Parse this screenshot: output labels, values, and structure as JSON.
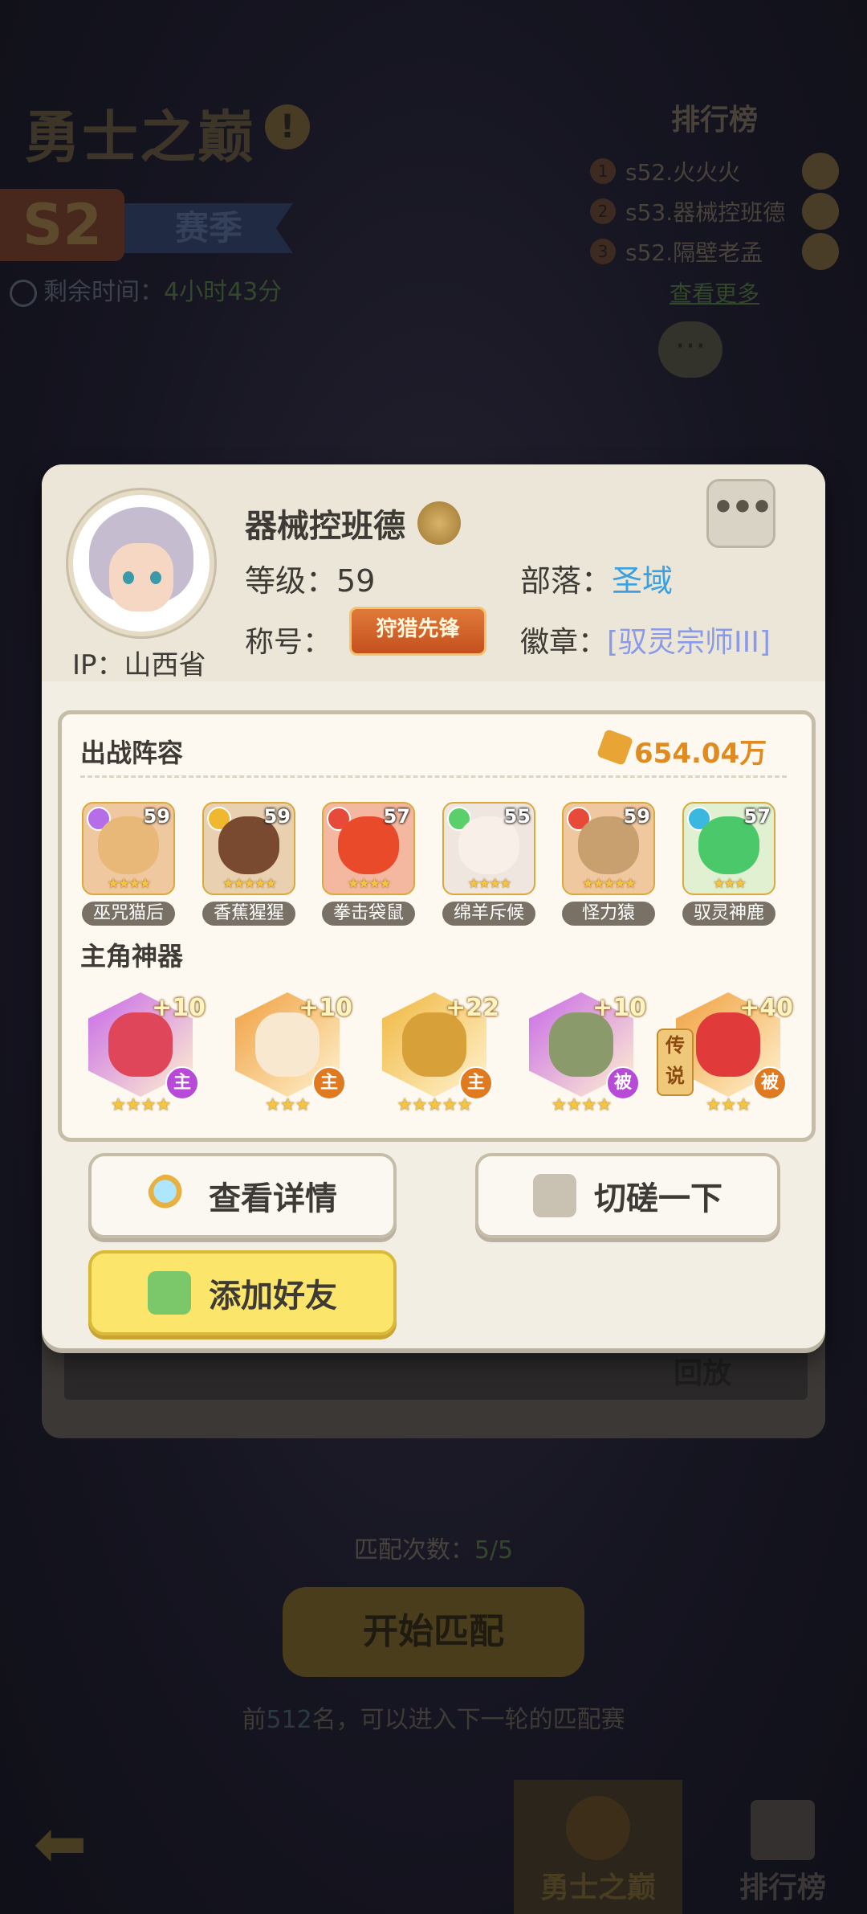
{
  "header": {
    "game_title": "勇士之巅",
    "info_icon": "!",
    "season_code": "S2",
    "season_label": "赛季",
    "remaining_label": "剩余时间：",
    "remaining_value": "4小时43分"
  },
  "ranking": {
    "title": "排行榜",
    "entries": [
      {
        "rank": "1",
        "name": "s52.火火火"
      },
      {
        "rank": "2",
        "name": "s53.器械控班德"
      },
      {
        "rank": "3",
        "name": "s52.隔壁老孟"
      }
    ],
    "see_more": "查看更多"
  },
  "chat_icon": "chat-bubble-icon",
  "profile": {
    "name": "器械控班德",
    "level_label": "等级：",
    "level_value": "59",
    "tribe_label": "部落：",
    "tribe_value": "圣域",
    "title_label": "称号：",
    "title_value": "狩猎先锋",
    "badge_label": "徽章：",
    "badge_value": "[驭灵宗师III]",
    "ip_label": "IP：山西省",
    "more_label": "•••"
  },
  "lineup": {
    "title": "出战阵容",
    "power": "654.04万",
    "heroes": [
      {
        "name": "巫咒猫后",
        "level": "59",
        "stars": "★★★★",
        "element_color": "#b56ee8",
        "bg": "#f0c8a0",
        "skin": "#e8b878"
      },
      {
        "name": "香蕉猩猩",
        "level": "59",
        "stars": "★★★★★",
        "element_color": "#f0b830",
        "bg": "#e8d0b0",
        "skin": "#7a4a30"
      },
      {
        "name": "拳击袋鼠",
        "level": "57",
        "stars": "★★★★",
        "element_color": "#e84a3a",
        "bg": "#f4b8a0",
        "skin": "#e84a2a"
      },
      {
        "name": "绵羊斥候",
        "level": "55",
        "stars": "★★★★",
        "element_color": "#5ad06a",
        "bg": "#f0e6e0",
        "skin": "#f7efe8"
      },
      {
        "name": "怪力猿",
        "level": "59",
        "stars": "★★★★★",
        "element_color": "#e84a3a",
        "bg": "#f0c8a0",
        "skin": "#c8a070"
      },
      {
        "name": "驭灵神鹿",
        "level": "57",
        "stars": "★★★",
        "element_color": "#3ab8e0",
        "bg": "#e0f0d0",
        "skin": "#4ac86a"
      }
    ]
  },
  "artifacts": {
    "title": "主角神器",
    "items": [
      {
        "plus": "+10",
        "tag": "主",
        "stars": "★★★★",
        "color": "#c86ae8",
        "inner": "#e0465a",
        "tag_color": "#b84ad8"
      },
      {
        "plus": "+10",
        "tag": "主",
        "stars": "★★★",
        "color": "#f0a040",
        "inner": "#f8e8d0",
        "tag_color": "#e07a20"
      },
      {
        "plus": "+22",
        "tag": "主",
        "stars": "★★★★★",
        "color": "#f0b840",
        "inner": "#d8a038",
        "tag_color": "#e07a20"
      },
      {
        "plus": "+10",
        "tag": "被",
        "stars": "★★★★",
        "color": "#c86ae8",
        "inner": "#8a9a6a",
        "tag_color": "#b84ad8"
      },
      {
        "plus": "+40",
        "tag": "被",
        "stars": "★★★",
        "color": "#f0a040",
        "inner": "#e03a3a",
        "tag_color": "#e07a20"
      }
    ],
    "legend_tag": "传说"
  },
  "buttons": {
    "detail": "查看详情",
    "spar": "切磋一下",
    "add_friend": "添加好友"
  },
  "background_page": {
    "replay": "回放",
    "match_count_label": "匹配次数：",
    "match_count_value": "5/5",
    "start_match": "开始匹配",
    "rank_note_prefix": "前",
    "rank_note_value": "512",
    "rank_note_suffix": "名，可以进入下一轮的匹配赛",
    "back_icon": "back-arrow-icon",
    "tabs": [
      {
        "label": "勇士之巅",
        "active": true
      },
      {
        "label": "排行榜",
        "active": false
      }
    ]
  }
}
